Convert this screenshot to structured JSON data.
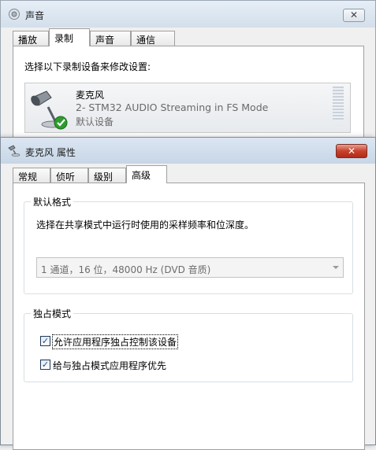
{
  "sound_window": {
    "title": "声音",
    "close": "✕",
    "tabs": [
      "播放",
      "录制",
      "声音",
      "通信"
    ],
    "active_tab": "录制",
    "instruction": "选择以下录制设备来修改设置:",
    "device": {
      "name": "麦克风",
      "description": "2- STM32 AUDIO Streaming in FS Mode",
      "status": "默认设备",
      "icon": "microphone-icon",
      "badge": "green-check-icon"
    }
  },
  "props_window": {
    "title": "麦克风 属性",
    "close": "✕",
    "tabs": [
      "常规",
      "侦听",
      "级别",
      "高级"
    ],
    "active_tab": "高级",
    "default_format": {
      "legend": "默认格式",
      "description": "选择在共享模式中运行时使用的采样频率和位深度。",
      "selected": "1 通道，16 位，48000 Hz (DVD 音质)"
    },
    "exclusive_mode": {
      "legend": "独占模式",
      "options": [
        {
          "label": "允许应用程序独占控制该设备",
          "checked": true
        },
        {
          "label": "给与独占模式应用程序优先",
          "checked": true
        }
      ]
    }
  },
  "colors": {
    "close_button": "#c7412c",
    "check": "#2e9c2e"
  }
}
